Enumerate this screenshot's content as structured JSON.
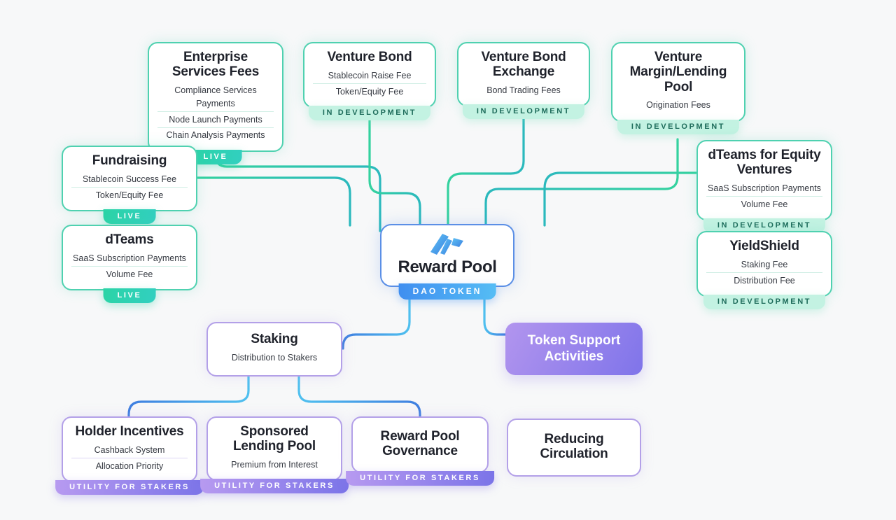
{
  "hub": {
    "title": "Reward Pool",
    "badge": "DAO TOKEN",
    "logo_icon": "reward-pool-logo-icon"
  },
  "statuses": {
    "live": "LIVE",
    "in_development": "IN DEVELOPMENT",
    "utility": "UTILITY FOR STAKERS"
  },
  "colors": {
    "background": "#f7f8f9",
    "green_border": "#4fd1b0",
    "blue_border": "#6aa7f0",
    "purple_border": "#b3a0e8",
    "live_badge": "#2bd4a6",
    "dev_badge": "#c3f2e2",
    "dev_badge_text": "#1d6b5a",
    "utility_badge": "#8b7ce8",
    "dao_badge": "#3f8ef0",
    "wire_green": "#2ec6a8",
    "wire_blue": "#3a9fe0",
    "title_text": "#1f222b"
  },
  "nodes": [
    {
      "id": "enterprise-services-fees",
      "title": "Enterprise Services Fees",
      "subs": [
        "Compliance Services Payments",
        "Node Launch Payments",
        "Chain Analysis Payments"
      ],
      "status": "LIVE",
      "accent": "green"
    },
    {
      "id": "venture-bond",
      "title": "Venture Bond",
      "subs": [
        "Stablecoin Raise Fee",
        "Token/Equity Fee"
      ],
      "status": "IN DEVELOPMENT",
      "accent": "green"
    },
    {
      "id": "venture-bond-exchange",
      "title": "Venture Bond Exchange",
      "subs": [
        "Bond Trading Fees"
      ],
      "status": "IN DEVELOPMENT",
      "accent": "green"
    },
    {
      "id": "venture-margin-lending-pool",
      "title": "Venture Margin/Lending Pool",
      "subs": [
        "Origination Fees"
      ],
      "status": "IN DEVELOPMENT",
      "accent": "green"
    },
    {
      "id": "fundraising",
      "title": "Fundraising",
      "subs": [
        "Stablecoin Success Fee",
        "Token/Equity Fee"
      ],
      "status": "LIVE",
      "accent": "green"
    },
    {
      "id": "dteams",
      "title": "dTeams",
      "subs": [
        "SaaS Subscription Payments",
        "Volume Fee"
      ],
      "status": "LIVE",
      "accent": "green"
    },
    {
      "id": "dteams-for-equity-ventures",
      "title": "dTeams for Equity Ventures",
      "subs": [
        "SaaS Subscription Payments",
        "Volume Fee"
      ],
      "status": "IN DEVELOPMENT",
      "accent": "green"
    },
    {
      "id": "yieldshield",
      "title": "YieldShield",
      "subs": [
        "Staking Fee",
        "Distribution Fee"
      ],
      "status": "IN DEVELOPMENT",
      "accent": "green"
    },
    {
      "id": "staking",
      "title": "Staking",
      "subs": [
        "Distribution to Stakers"
      ],
      "status": "",
      "accent": "purple"
    },
    {
      "id": "token-support-activities",
      "title": "Token Support Activities",
      "subs": [],
      "status": "",
      "accent": "solid-purple"
    },
    {
      "id": "holder-incentives",
      "title": "Holder Incentives",
      "subs": [
        "Cashback System",
        "Allocation Priority"
      ],
      "status": "UTILITY FOR STAKERS",
      "accent": "purple"
    },
    {
      "id": "sponsored-lending-pool",
      "title": "Sponsored Lending Pool",
      "subs": [
        "Premium from Interest"
      ],
      "status": "UTILITY FOR STAKERS",
      "accent": "purple"
    },
    {
      "id": "reward-pool-governance",
      "title": "Reward Pool Governance",
      "subs": [],
      "status": "UTILITY FOR STAKERS",
      "accent": "purple"
    },
    {
      "id": "reducing-circulation",
      "title": "Reducing Circulation",
      "subs": [],
      "status": "",
      "accent": "purple"
    }
  ]
}
